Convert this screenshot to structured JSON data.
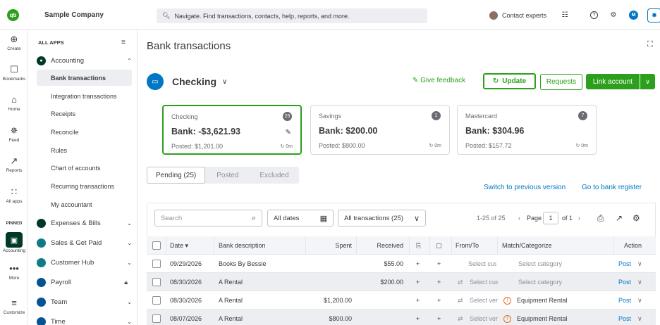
{
  "topbar": {
    "logo": "qb",
    "company": "Sample Company",
    "search_placeholder": "Navigate. Find transactions, contacts, help, reports, and more.",
    "contact_experts": "Contact experts",
    "user_initial": "M"
  },
  "rail": {
    "items": [
      "Create",
      "Bookmarks",
      "Home",
      "Feed",
      "Reports",
      "All apps"
    ],
    "pinned": "PINNED",
    "accounting": "Accounting",
    "more": "More",
    "customize": "Customize"
  },
  "sidebar": {
    "all_apps": "ALL APPS",
    "section": "Accounting",
    "items": [
      "Bank transactions",
      "Integration transactions",
      "Receipts",
      "Reconcile",
      "Rules",
      "Chart of accounts",
      "Recurring transactions",
      "My accountant"
    ],
    "groups": [
      "Expenses & Bills",
      "Sales & Get Paid",
      "Customer Hub",
      "Payroll",
      "Team",
      "Time"
    ]
  },
  "main": {
    "title": "Bank transactions",
    "account": "Checking",
    "give_feedback": "Give feedback",
    "update": "Update",
    "requests": "Requests",
    "link_account": "Link account",
    "cards": [
      {
        "name": "Checking",
        "count": "25",
        "bank": "Bank: -$3,621.93",
        "posted": "Posted: $1,201.00",
        "sync": "0m"
      },
      {
        "name": "Savings",
        "count": "1",
        "bank": "Bank: $200.00",
        "posted": "Posted: $800.00",
        "sync": "0m"
      },
      {
        "name": "Mastercard",
        "count": "7",
        "bank": "Bank: $304.96",
        "posted": "Posted: $157.72",
        "sync": "0m"
      }
    ],
    "tabs": [
      "Pending (25)",
      "Posted",
      "Excluded"
    ],
    "switch_link": "Switch to previous version",
    "register_link": "Go to bank register",
    "toolbar": {
      "search_placeholder": "Search",
      "dates": "All dates",
      "filter": "All transactions (25)",
      "range": "1-25 of 25",
      "page_label": "Page",
      "page": "1",
      "of": "of 1"
    },
    "columns": {
      "date": "Date",
      "desc": "Bank description",
      "spent": "Spent",
      "received": "Received",
      "fromto": "From/To",
      "match": "Match/Categorize",
      "action": "Action"
    },
    "rows": [
      {
        "date": "09/29/2026",
        "desc": "Books By Bessie",
        "spent": "",
        "received": "$55.00",
        "fromto": "Select cus",
        "match": "Select category",
        "action": "Post"
      },
      {
        "date": "08/30/2026",
        "desc": "A Rental",
        "spent": "",
        "received": "$200.00",
        "fromto": "Select cus",
        "match": "Select category",
        "action": "Post"
      },
      {
        "date": "08/30/2026",
        "desc": "A Rental",
        "spent": "$1,200.00",
        "received": "",
        "fromto": "Select ver",
        "match": "Equipment Rental",
        "action": "Post"
      },
      {
        "date": "08/07/2026",
        "desc": "A Rental",
        "spent": "$800.00",
        "received": "",
        "fromto": "Select ver",
        "match": "Equipment Rental",
        "action": "Post"
      }
    ]
  },
  "colors": {
    "green": "#2ca01c",
    "blue": "#0077c5",
    "dark_green": "#00392a"
  }
}
